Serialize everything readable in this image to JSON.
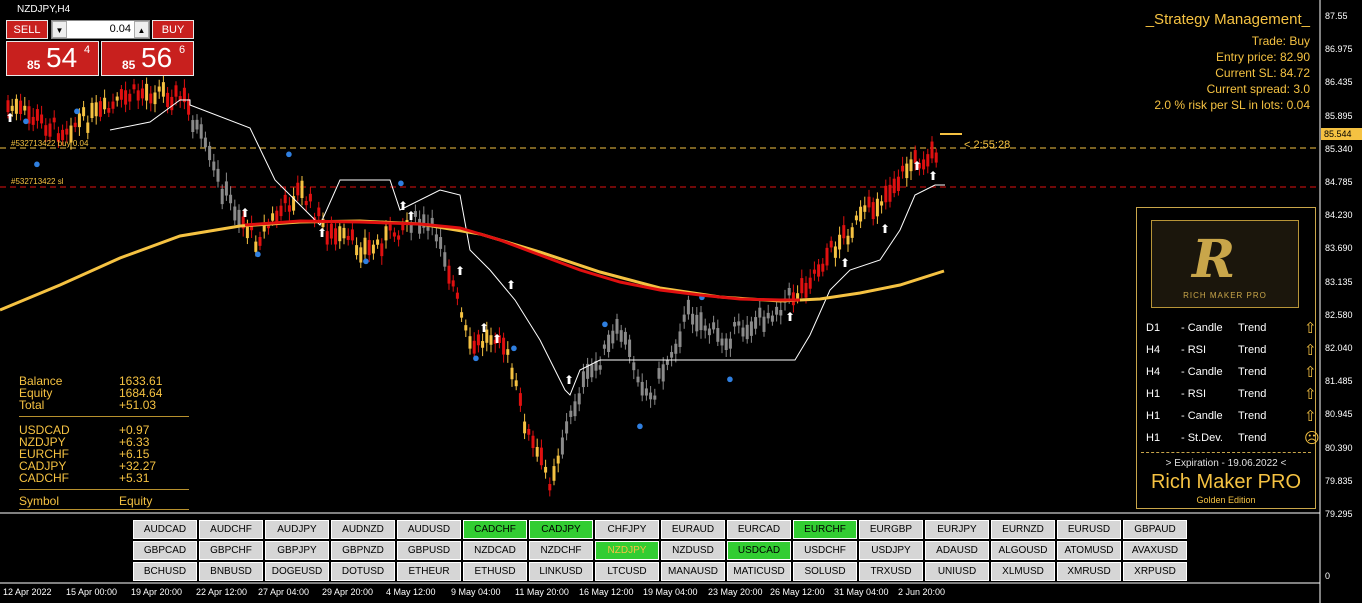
{
  "window": {
    "title": "NZDJPY,H4"
  },
  "trade_panel": {
    "sell_label": "SELL",
    "buy_label": "BUY",
    "lot": "0.04",
    "bid": {
      "prefix": "85",
      "big": "54",
      "sup": "4"
    },
    "ask": {
      "prefix": "85",
      "big": "56",
      "sup": "6"
    }
  },
  "strategy": {
    "title": "_Strategy Management_",
    "lines": [
      "Trade: Buy",
      "Entry price: 82.90",
      "Current SL: 84.72",
      "Current spread: 3.0",
      "2.0 % risk per SL in lots: 0.04"
    ]
  },
  "price_axis": {
    "labels": [
      "87.55",
      "86.975",
      "86.435",
      "85.895",
      "85.340",
      "84.785",
      "84.230",
      "83.690",
      "83.135",
      "82.580",
      "82.040",
      "81.485",
      "80.945",
      "80.390",
      "79.835",
      "79.295"
    ],
    "current": "85.544",
    "indicator_scale": "0"
  },
  "chart_labels": {
    "order_buy": "#532713422 buy 0.04",
    "order_sl": "#532713422 sl",
    "countdown": "< 2:55:28"
  },
  "account": {
    "balance_label": "Balance",
    "balance": "1633.61",
    "equity_label": "Equity",
    "equity": "1684.64",
    "total_label": "Total",
    "total": "+51.03",
    "positions": [
      {
        "symbol": "USDCAD",
        "value": "+0.97"
      },
      {
        "symbol": "NZDJPY",
        "value": "+6.33"
      },
      {
        "symbol": "EURCHF",
        "value": "+6.15"
      },
      {
        "symbol": "CADJPY",
        "value": "+32.27"
      },
      {
        "symbol": "CADCHF",
        "value": "+5.31"
      }
    ],
    "footer_symbol": "Symbol",
    "footer_equity": "Equity"
  },
  "trend_panel": {
    "brand_sub": "RICH MAKER PRO",
    "rows": [
      {
        "tf": "D1",
        "name": "- Candle",
        "trend": "Trend",
        "icon": "arrow-up-icon",
        "glyph": "⇧"
      },
      {
        "tf": "H4",
        "name": "- RSI",
        "trend": "Trend",
        "icon": "arrow-up-icon",
        "glyph": "⇧"
      },
      {
        "tf": "H4",
        "name": "- Candle",
        "trend": "Trend",
        "icon": "arrow-up-icon",
        "glyph": "⇧"
      },
      {
        "tf": "H1",
        "name": "- RSI",
        "trend": "Trend",
        "icon": "arrow-up-icon",
        "glyph": "⇧"
      },
      {
        "tf": "H1",
        "name": "- Candle",
        "trend": "Trend",
        "icon": "arrow-up-icon",
        "glyph": "⇧"
      },
      {
        "tf": "H1",
        "name": "- St.Dev.",
        "trend": "Trend",
        "icon": "sad-face-icon",
        "glyph": "☹"
      }
    ],
    "expiration": "> Expiration - 19.06.2022 <",
    "product": "Rich Maker PRO",
    "edition": "Golden  Edition"
  },
  "symbols": [
    {
      "label": "AUDCAD",
      "state": "off"
    },
    {
      "label": "AUDCHF",
      "state": "off"
    },
    {
      "label": "AUDJPY",
      "state": "off"
    },
    {
      "label": "AUDNZD",
      "state": "off"
    },
    {
      "label": "AUDUSD",
      "state": "off"
    },
    {
      "label": "CADCHF",
      "state": "on"
    },
    {
      "label": "CADJPY",
      "state": "on"
    },
    {
      "label": "CHFJPY",
      "state": "off"
    },
    {
      "label": "EURAUD",
      "state": "off"
    },
    {
      "label": "EURCAD",
      "state": "off"
    },
    {
      "label": "EURCHF",
      "state": "on"
    },
    {
      "label": "EURGBP",
      "state": "off"
    },
    {
      "label": "EURJPY",
      "state": "off"
    },
    {
      "label": "EURNZD",
      "state": "off"
    },
    {
      "label": "EURUSD",
      "state": "off"
    },
    {
      "label": "GBPAUD",
      "state": "off"
    },
    {
      "label": "GBPCAD",
      "state": "off"
    },
    {
      "label": "GBPCHF",
      "state": "off"
    },
    {
      "label": "GBPJPY",
      "state": "off"
    },
    {
      "label": "GBPNZD",
      "state": "off"
    },
    {
      "label": "GBPUSD",
      "state": "off"
    },
    {
      "label": "NZDCAD",
      "state": "off"
    },
    {
      "label": "NZDCHF",
      "state": "off"
    },
    {
      "label": "NZDJPY",
      "state": "current"
    },
    {
      "label": "NZDUSD",
      "state": "off"
    },
    {
      "label": "USDCAD",
      "state": "on"
    },
    {
      "label": "USDCHF",
      "state": "off"
    },
    {
      "label": "USDJPY",
      "state": "off"
    },
    {
      "label": "ADAUSD",
      "state": "off"
    },
    {
      "label": "ALGOUSD",
      "state": "off"
    },
    {
      "label": "ATOMUSD",
      "state": "off"
    },
    {
      "label": "AVAXUSD",
      "state": "off"
    },
    {
      "label": "BCHUSD",
      "state": "off"
    },
    {
      "label": "BNBUSD",
      "state": "off"
    },
    {
      "label": "DOGEUSD",
      "state": "off"
    },
    {
      "label": "DOTUSD",
      "state": "off"
    },
    {
      "label": "ETHEUR",
      "state": "off"
    },
    {
      "label": "ETHUSD",
      "state": "off"
    },
    {
      "label": "LINKUSD",
      "state": "off"
    },
    {
      "label": "LTCUSD",
      "state": "off"
    },
    {
      "label": "MANAUSD",
      "state": "off"
    },
    {
      "label": "MATICUSD",
      "state": "off"
    },
    {
      "label": "SOLUSD",
      "state": "off"
    },
    {
      "label": "TRXUSD",
      "state": "off"
    },
    {
      "label": "UNIUSD",
      "state": "off"
    },
    {
      "label": "XLMUSD",
      "state": "off"
    },
    {
      "label": "XMRUSD",
      "state": "off"
    },
    {
      "label": "XRPUSD",
      "state": "off"
    }
  ],
  "time_axis": [
    "12 Apr 2022",
    "15 Apr 00:00",
    "19 Apr 20:00",
    "22 Apr 12:00",
    "27 Apr 04:00",
    "29 Apr 20:00",
    "4 May 12:00",
    "9 May 04:00",
    "11 May 20:00",
    "16 May 12:00",
    "19 May 04:00",
    "23 May 20:00",
    "26 May 12:00",
    "31 May 04:00",
    "2 Jun 20:00"
  ],
  "colors": {
    "bull": "#f5c242",
    "bear": "#e01010",
    "ma_slow": "#e01010",
    "ma_fast": "#f5c242",
    "active": "#32cd32"
  }
}
